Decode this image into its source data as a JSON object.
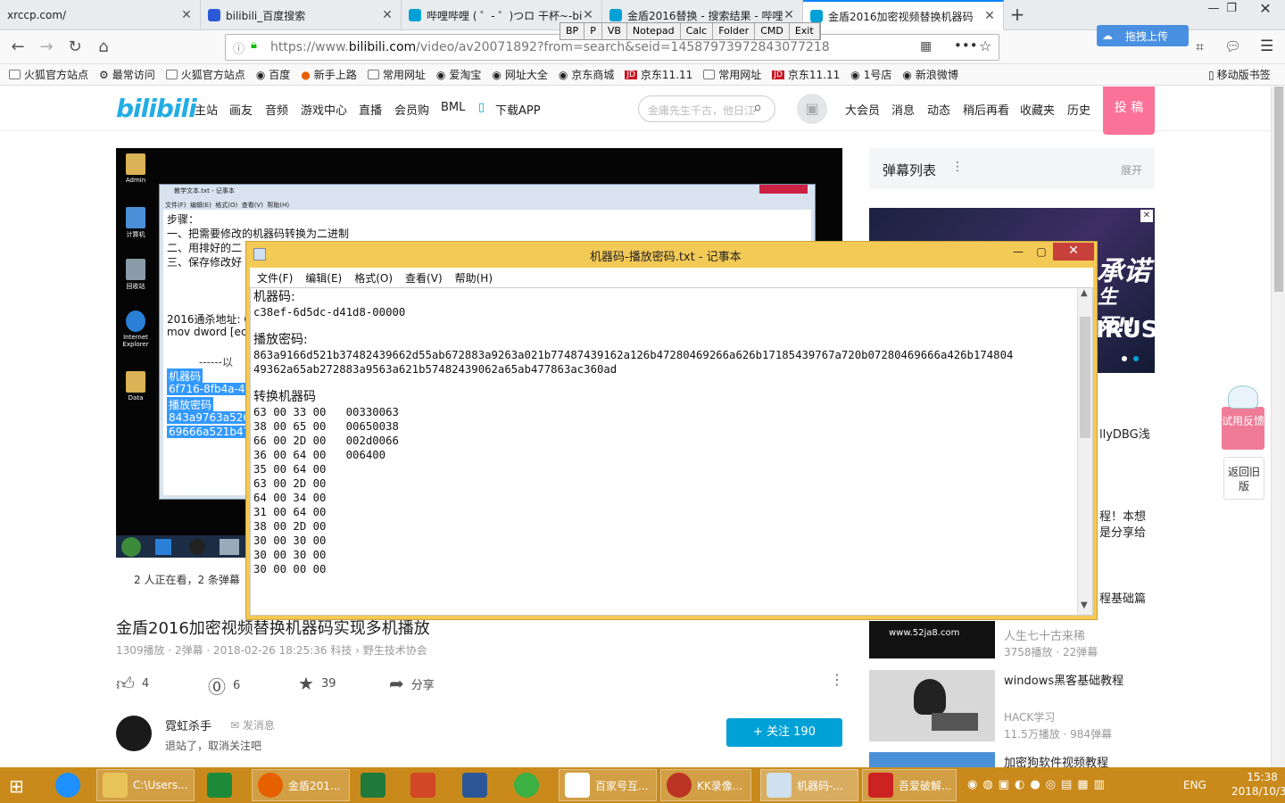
{
  "browser": {
    "tabs": [
      {
        "title": "xrccp.com/",
        "color": "#888"
      },
      {
        "title": "bilibili_百度搜索",
        "color": "#2a5ad8"
      },
      {
        "title": "哔哩哔哩 ( ゜- ゜)つロ 干杯~-bili",
        "color": "#00a1d6"
      },
      {
        "title": "金盾2016替换 - 搜索结果 - 哔哩",
        "color": "#00a1d6"
      },
      {
        "title": "金盾2016加密视频替换机器码",
        "color": "#00a1d6"
      }
    ],
    "url_prefix": "https://www.",
    "url_domain": "bilibili.com",
    "url_rest": "/video/av20071892?from=search&seid=14587973972843077218",
    "toolbox": [
      "BP",
      "P",
      "VB",
      "Notepad",
      "Calc",
      "Folder",
      "CMD",
      "Exit"
    ],
    "upload_label": "拖拽上传",
    "bookmarks": [
      "火狐官方站点",
      "最常访问",
      "火狐官方站点",
      "百度",
      "新手上路",
      "常用网址",
      "爱淘宝",
      "网址大全",
      "京东商城",
      "京东11.11",
      "常用网址",
      "京东11.11",
      "1号店",
      "新浪微博"
    ],
    "mobile_bookmarks": "移动版书签"
  },
  "site": {
    "logo": "bilibili",
    "nav": [
      "主站",
      "画友",
      "音频",
      "游戏中心",
      "直播",
      "会员购",
      "BML",
      "下载APP"
    ],
    "search_placeholder": "金庸先生千古，他日江",
    "right_nav": [
      "大会员",
      "消息",
      "动态",
      "稍后再看",
      "收藏夹",
      "历史"
    ],
    "upload_btn": "投 稿"
  },
  "video": {
    "desktop_icons": [
      "Admin",
      "计算机",
      "回收站",
      "Internet Explorer",
      "Data"
    ],
    "inner_title": "教学文本.txt - 记事本",
    "inner_menu": "文件(F)  编辑(E)  格式(O)  查看(V)  帮助(H)",
    "inner_lines": [
      "步骤：",
      "一、把需要修改的机器码转换为二进制",
      "二、用排好的二",
      "三、保存修改好",
      "2016通杀地址: C",
      "mov dword [ec",
      "------以"
    ],
    "inner_hl": [
      "机器码",
      "6f716-8fb4a-4f",
      "播放密码",
      "843a9763a526",
      "69666a521b47"
    ],
    "viewers": "2 人正在看，2 条弹幕",
    "title": "金盾2016加密视频替换机器码实现多机播放",
    "meta": "1309播放 · 2弹幕 · 2018-02-26 18:25:36     科技 › 野生技术协会",
    "likes": "4",
    "coins": "6",
    "favs": "39",
    "share": "分享",
    "up_name": "霓虹杀手",
    "up_msg": "发消息",
    "up_sign": "退站了，取消关注吧",
    "follow": "+ 关注 190"
  },
  "sidebar": {
    "danmu_title": "弹幕列表",
    "danmu_expand": "展开",
    "ad_text_1": "承诺",
    "ad_text_2": "生死!!",
    "ad_text_3": "IRUS",
    "partial_1": "llyDBG浅",
    "partial_2": "程！本想",
    "partial_3": "是分享给",
    "partial_4": "程基础篇",
    "items": [
      {
        "thumb_text": "www.52ja8.com",
        "title": "人生七十古来稀",
        "meta": "3758播放 · 22弹幕"
      },
      {
        "title": "windows黑客基础教程",
        "up": "HACK学习",
        "meta": "11.5万播放 · 984弹幕"
      },
      {
        "title": "加密狗软件视频教程"
      }
    ],
    "try_label": "试用反馈",
    "old_label": "返回旧版"
  },
  "notepad": {
    "title": "机器码-播放密码.txt - 记事本",
    "menu": [
      "文件(F)",
      "编辑(E)",
      "格式(O)",
      "查看(V)",
      "帮助(H)"
    ],
    "label_machine": "机器码:",
    "machine": "c38ef-6d5dc-d41d8-00000",
    "label_pwd": "播放密码:",
    "pwd1": "863a9166d521b37482439662d55ab672883a9263a021b77487439162a126b47280469266a626b17185439767a720b07280469666a426b174804",
    "pwd2": "49362a65ab272883a9563a621b57482439062a65ab477863ac360ad",
    "label_convert": "转换机器码",
    "rows": [
      "63 00 33 00   00330063",
      "38 00 65 00   00650038",
      "66 00 2D 00   002d0066",
      "36 00 64 00   006400",
      "35 00 64 00",
      "63 00 2D 00",
      "64 00 34 00",
      "31 00 64 00",
      "38 00 2D 00",
      "30 00 30 00",
      "30 00 30 00",
      "30 00 00 00"
    ]
  },
  "taskbar": {
    "items": [
      "C:\\Users...",
      "金盾201...",
      "百家号互...",
      "KK录像...",
      "机器码-...",
      "吾爱破解..."
    ],
    "lang": "ENG",
    "time": "15:38",
    "date": "2018/10/31"
  }
}
